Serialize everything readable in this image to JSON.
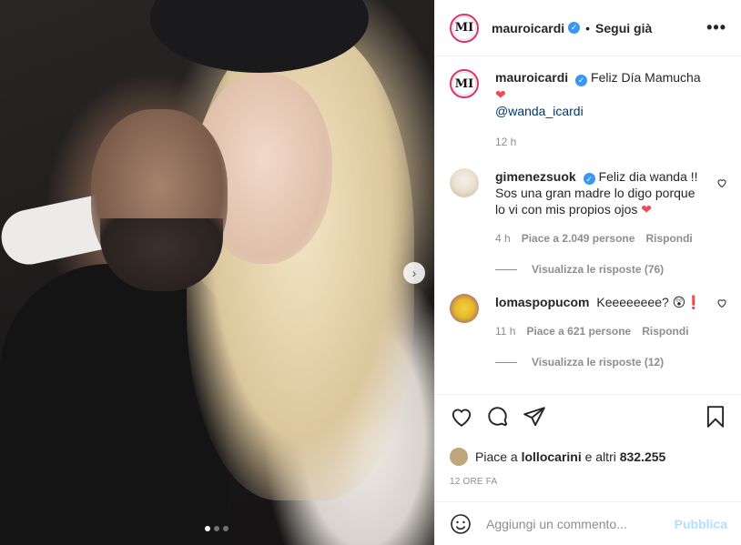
{
  "post": {
    "username": "mauroicardi",
    "follow_label": "Segui già",
    "separator": "•",
    "more_label": "•••",
    "avatar_text": "MI"
  },
  "caption": {
    "username": "mauroicardi",
    "text": "Feliz Día Mamucha",
    "emoji": "❤",
    "mention": "@wanda_icardi",
    "time": "12 h"
  },
  "comments": [
    {
      "username": "gimenezsuok",
      "text": "Feliz dia wanda !! Sos una gran madre lo digo porque lo vi con mis propios ojos",
      "emoji": "❤",
      "time": "4 h",
      "likes": "Piace a 2.049 persone",
      "reply": "Rispondi",
      "view_replies": "Visualizza le risposte (76)"
    },
    {
      "username": "lomaspopucom",
      "text": "Keeeeeeee?",
      "emoji": "😲❗",
      "time": "11 h",
      "likes": "Piace a 621 persone",
      "reply": "Rispondi",
      "view_replies": "Visualizza le risposte (12)"
    }
  ],
  "actions": {
    "icons": [
      "heart-icon",
      "comment-icon",
      "share-icon",
      "bookmark-icon"
    ],
    "likes_prefix": "Piace a",
    "likes_user": "lollocarini",
    "likes_mid": "e altri",
    "likes_count": "832.255",
    "timestamp": "12 ORE FA"
  },
  "composer": {
    "placeholder": "Aggiungi un commento...",
    "publish_label": "Pubblica"
  },
  "carousel": {
    "slide_count": 3,
    "active_index": 0,
    "next_label": "›"
  },
  "colors": {
    "verified": "#3897f0",
    "heart": "#ed4956",
    "publish_disabled": "#b2dffc",
    "muted": "#8e8e8e"
  }
}
